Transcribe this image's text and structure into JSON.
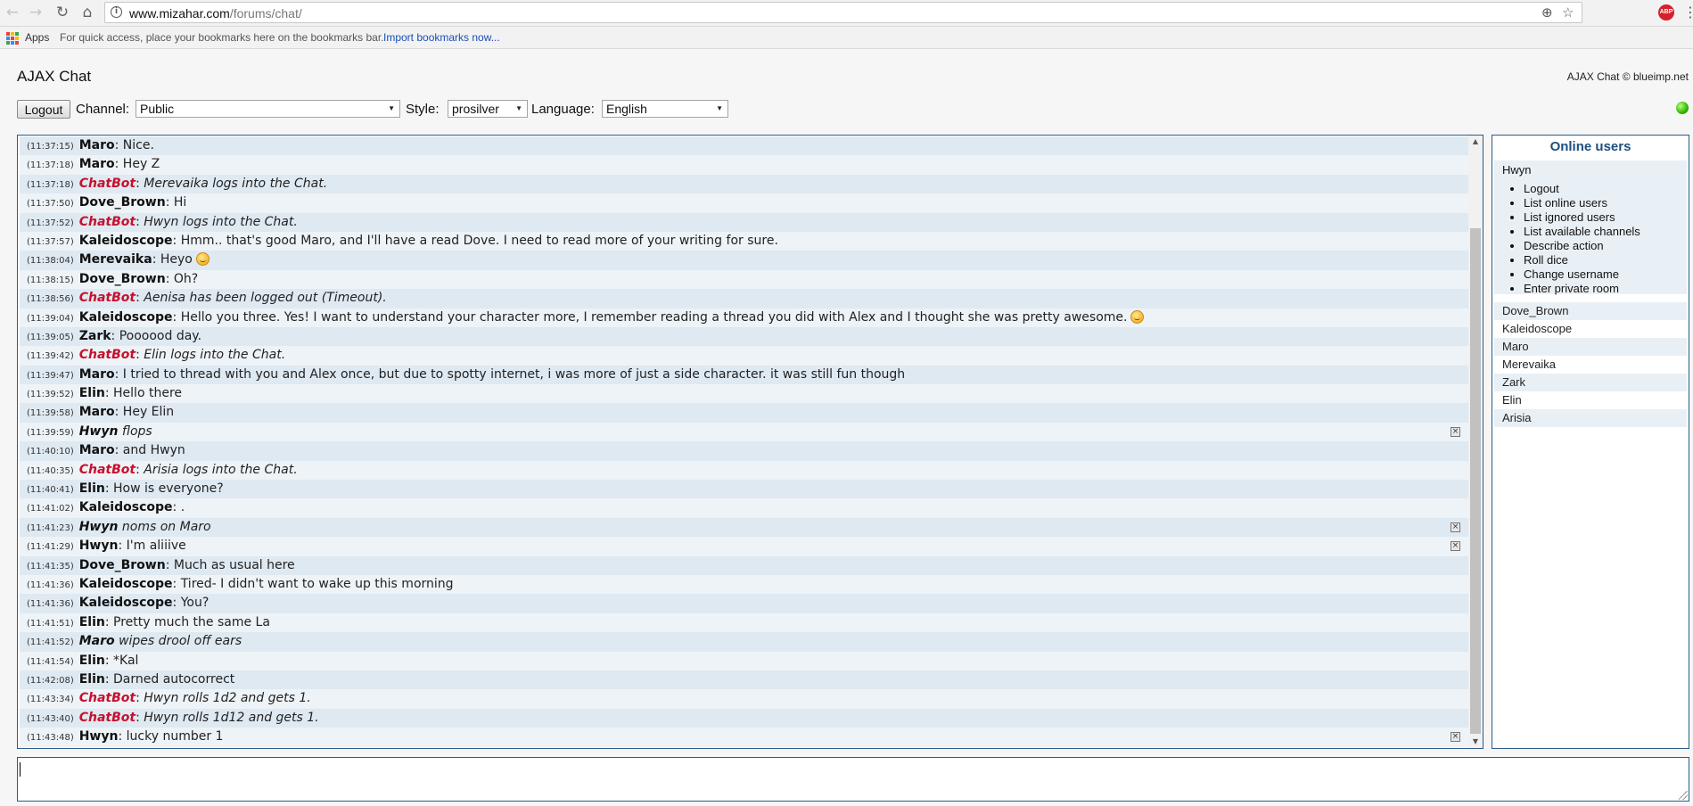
{
  "browser": {
    "url_host": "www.mizahar.com",
    "url_path": "/forums/chat/",
    "apps_label": "Apps",
    "bookmarks_message": "For quick access, place your bookmarks here on the bookmarks bar.",
    "import_link": "Import bookmarks now...",
    "abp_label": "ABP",
    "icons": [
      "back-icon",
      "forward-icon",
      "reload-icon",
      "home-icon",
      "info-icon",
      "zoom-icon",
      "star-icon",
      "adblock-icon",
      "menu-icon",
      "apps-icon"
    ]
  },
  "header": {
    "title": "AJAX Chat",
    "copyright": "AJAX Chat © blueimp.net"
  },
  "controls": {
    "logout_label": "Logout",
    "channel_label": "Channel:",
    "channel_value": "Public",
    "style_label": "Style:",
    "style_value": "prosilver",
    "language_label": "Language:",
    "language_value": "English"
  },
  "colors": {
    "chatbot": "#c7102e",
    "border": "#2b5c8a",
    "row_odd": "#dfe9f1",
    "row_even": "#eef3f7",
    "status_online": "#31b800"
  },
  "messages": [
    {
      "time": "(11:37:15)",
      "user": "Maro",
      "sep": ": ",
      "text": "Nice.",
      "type": "normal"
    },
    {
      "time": "(11:37:18)",
      "user": "Maro",
      "sep": ": ",
      "text": "Hey Z",
      "type": "normal"
    },
    {
      "time": "(11:37:18)",
      "user": "ChatBot",
      "sep": ": ",
      "text": "Merevaika logs into the Chat.",
      "type": "chatbot"
    },
    {
      "time": "(11:37:50)",
      "user": "Dove_Brown",
      "sep": ": ",
      "text": "Hi",
      "type": "normal"
    },
    {
      "time": "(11:37:52)",
      "user": "ChatBot",
      "sep": ": ",
      "text": "Hwyn logs into the Chat.",
      "type": "chatbot"
    },
    {
      "time": "(11:37:57)",
      "user": "Kaleidoscope",
      "sep": ": ",
      "text": "Hmm.. that's good Maro, and I'll have a read Dove. I need to read more of your writing for sure.",
      "type": "normal"
    },
    {
      "time": "(11:38:04)",
      "user": "Merevaika",
      "sep": ": ",
      "text": "Heyo",
      "type": "normal",
      "smiley": true
    },
    {
      "time": "(11:38:15)",
      "user": "Dove_Brown",
      "sep": ": ",
      "text": "Oh?",
      "type": "normal"
    },
    {
      "time": "(11:38:56)",
      "user": "ChatBot",
      "sep": ": ",
      "text": "Aenisa has been logged out (Timeout).",
      "type": "chatbot"
    },
    {
      "time": "(11:39:04)",
      "user": "Kaleidoscope",
      "sep": ": ",
      "text": "Hello you three. Yes! I want to understand your character more, I remember reading a thread you did with Alex and I thought she was pretty awesome.",
      "type": "normal",
      "smiley": true
    },
    {
      "time": "(11:39:05)",
      "user": "Zark",
      "sep": ": ",
      "text": "Poooood day.",
      "type": "normal"
    },
    {
      "time": "(11:39:42)",
      "user": "ChatBot",
      "sep": ": ",
      "text": "Elin logs into the Chat.",
      "type": "chatbot"
    },
    {
      "time": "(11:39:47)",
      "user": "Maro",
      "sep": ": ",
      "text": "I tried to thread with you and Alex once, but due to spotty internet, i was more of just a side character. it was still fun though",
      "type": "normal"
    },
    {
      "time": "(11:39:52)",
      "user": "Elin",
      "sep": ": ",
      "text": "Hello there",
      "type": "normal"
    },
    {
      "time": "(11:39:58)",
      "user": "Maro",
      "sep": ": ",
      "text": "Hey Elin",
      "type": "normal"
    },
    {
      "time": "(11:39:59)",
      "user": "Hwyn",
      "sep": " ",
      "text": "flops",
      "type": "action",
      "deletable": true
    },
    {
      "time": "(11:40:10)",
      "user": "Maro",
      "sep": ": ",
      "text": "and Hwyn",
      "type": "normal"
    },
    {
      "time": "(11:40:35)",
      "user": "ChatBot",
      "sep": ": ",
      "text": "Arisia logs into the Chat.",
      "type": "chatbot"
    },
    {
      "time": "(11:40:41)",
      "user": "Elin",
      "sep": ": ",
      "text": "How is everyone?",
      "type": "normal"
    },
    {
      "time": "(11:41:02)",
      "user": "Kaleidoscope",
      "sep": ": ",
      "text": ".",
      "type": "normal"
    },
    {
      "time": "(11:41:23)",
      "user": "Hwyn",
      "sep": " ",
      "text": "noms on Maro",
      "type": "action",
      "deletable": true
    },
    {
      "time": "(11:41:29)",
      "user": "Hwyn",
      "sep": ": ",
      "text": "I'm aliiive",
      "type": "normal",
      "deletable": true
    },
    {
      "time": "(11:41:35)",
      "user": "Dove_Brown",
      "sep": ": ",
      "text": "Much as usual here",
      "type": "normal"
    },
    {
      "time": "(11:41:36)",
      "user": "Kaleidoscope",
      "sep": ": ",
      "text": "Tired- I didn't want to wake up this morning",
      "type": "normal"
    },
    {
      "time": "(11:41:36)",
      "user": "Kaleidoscope",
      "sep": ": ",
      "text": "You?",
      "type": "normal"
    },
    {
      "time": "(11:41:51)",
      "user": "Elin",
      "sep": ": ",
      "text": "Pretty much the same La",
      "type": "normal"
    },
    {
      "time": "(11:41:52)",
      "user": "Maro",
      "sep": " ",
      "text": "wipes drool off ears",
      "type": "action"
    },
    {
      "time": "(11:41:54)",
      "user": "Elin",
      "sep": ": ",
      "text": "*Kal",
      "type": "normal"
    },
    {
      "time": "(11:42:08)",
      "user": "Elin",
      "sep": ": ",
      "text": "Darned autocorrect",
      "type": "normal"
    },
    {
      "time": "(11:43:34)",
      "user": "ChatBot",
      "sep": ": ",
      "text": "Hwyn rolls 1d2 and gets 1.",
      "type": "chatbot"
    },
    {
      "time": "(11:43:40)",
      "user": "ChatBot",
      "sep": ": ",
      "text": "Hwyn rolls 1d12 and gets 1.",
      "type": "chatbot"
    },
    {
      "time": "(11:43:48)",
      "user": "Hwyn",
      "sep": ": ",
      "text": "lucky number 1",
      "type": "normal",
      "deletable": true
    }
  ],
  "online": {
    "title": "Online users",
    "current_user": "Hwyn",
    "menu": [
      "Logout",
      "List online users",
      "List ignored users",
      "List available channels",
      "Describe action",
      "Roll dice",
      "Change username",
      "Enter private room"
    ],
    "users": [
      "Dove_Brown",
      "Kaleidoscope",
      "Maro",
      "Merevaika",
      "Zark",
      "Elin",
      "Arisia"
    ]
  },
  "input": {
    "value": ""
  }
}
